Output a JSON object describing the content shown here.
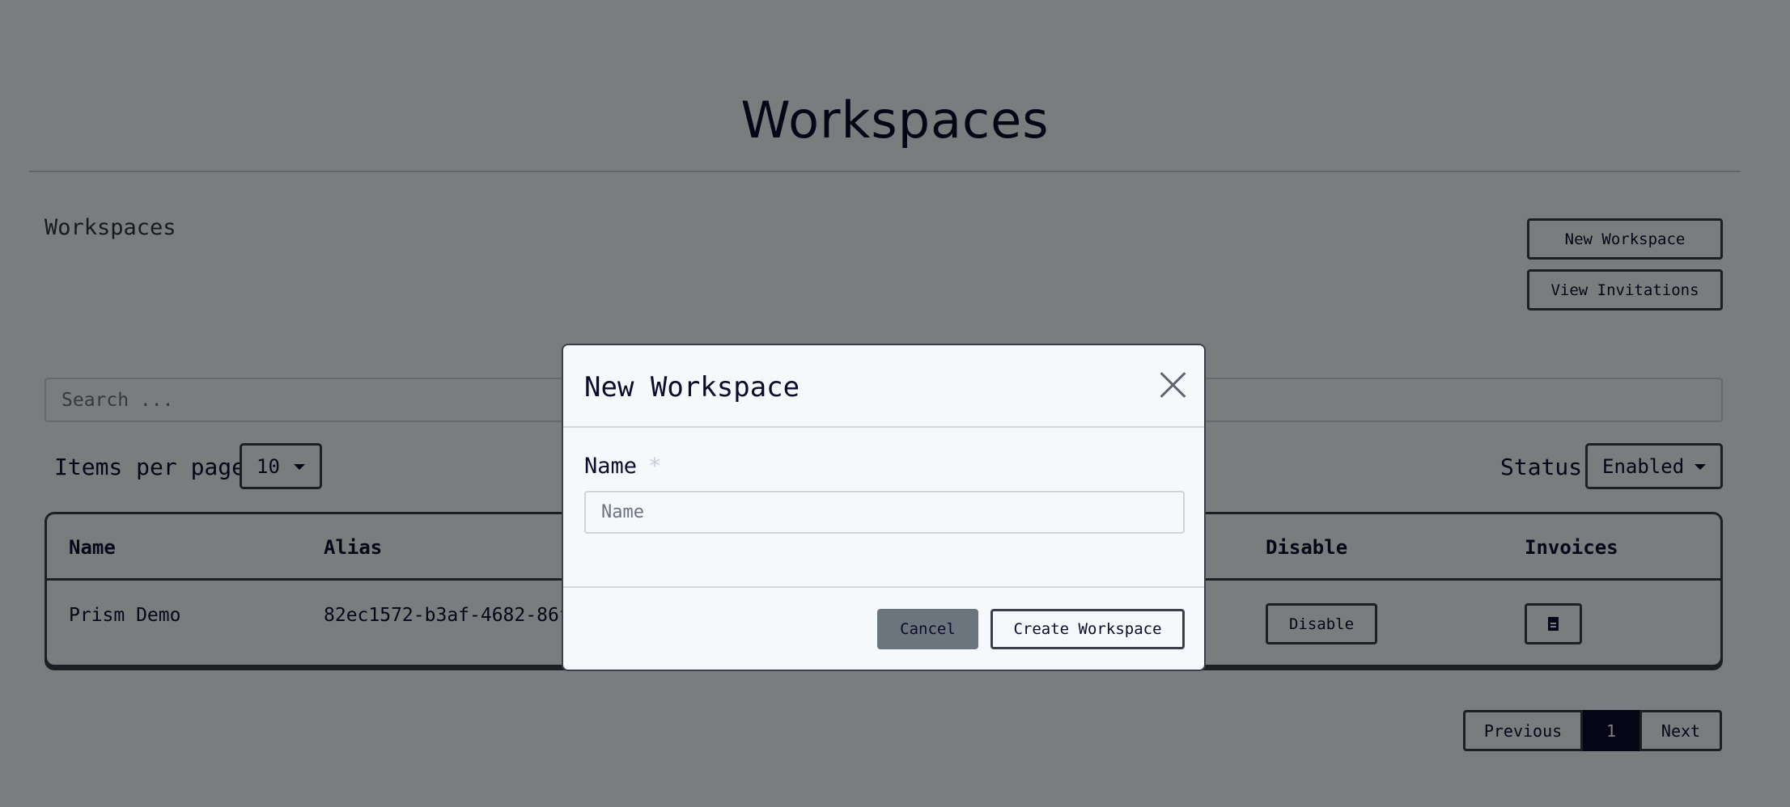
{
  "page": {
    "title": "Workspaces",
    "section_label": "Workspaces",
    "new_workspace_label": "New Workspace",
    "view_invitations_label": "View Invitations"
  },
  "search": {
    "placeholder": "Search ..."
  },
  "filters": {
    "items_per_page_label": "Items per page",
    "items_per_page_value": "10",
    "status_label": "Status",
    "status_value": "Enabled"
  },
  "table": {
    "columns": [
      "Name",
      "Alias",
      "Disable",
      "Invoices"
    ],
    "rows": [
      {
        "name": "Prism Demo",
        "alias": "82ec1572-b3af-4682-86f",
        "disable_label": "Disable"
      }
    ]
  },
  "pagination": {
    "previous": "Previous",
    "current": "1",
    "next": "Next"
  },
  "modal": {
    "title": "New Workspace",
    "name_label": "Name",
    "required_mark": "*",
    "name_placeholder": "Name",
    "cancel_label": "Cancel",
    "create_label": "Create Workspace"
  },
  "icons": {
    "close": "close-icon",
    "invoice": "file-invoice-icon"
  }
}
